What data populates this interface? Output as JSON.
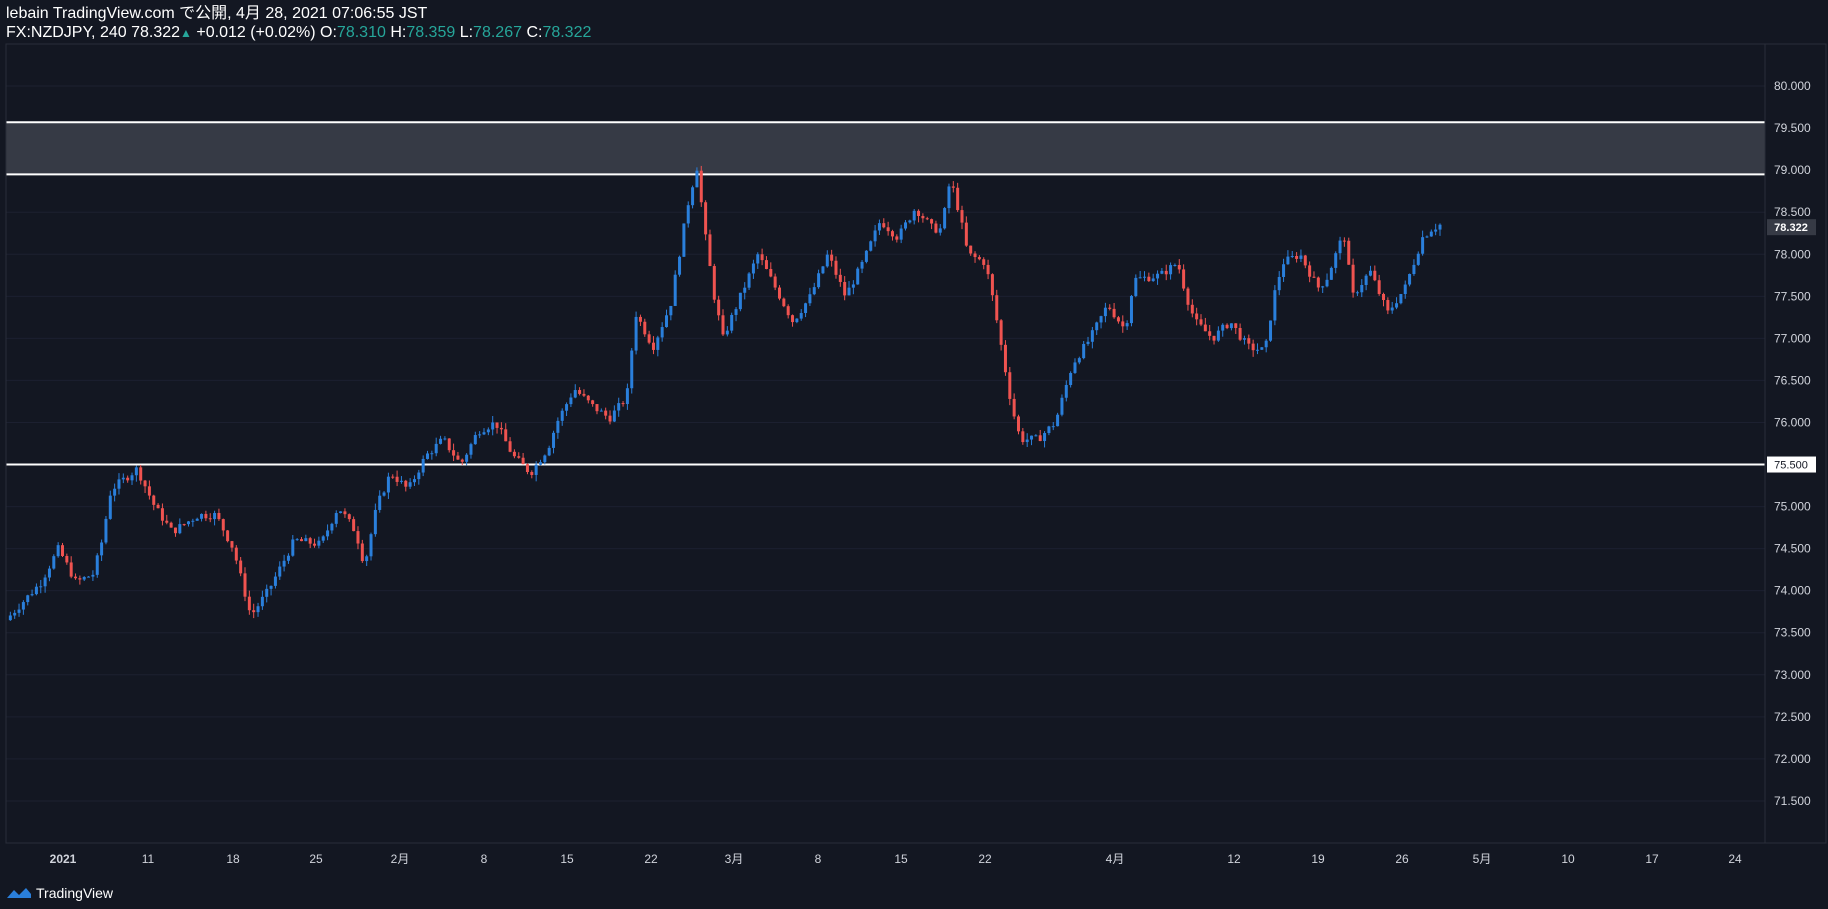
{
  "header": {
    "line1": "lebain TradingView.com で公開, 4月 28, 2021 07:06:55 JST",
    "symbol": "FX:NZDJPY, 240",
    "last": "78.322",
    "change": "+0.012 (+0.02%)",
    "o_label": "O:",
    "o": "78.310",
    "h_label": "H:",
    "h": "78.359",
    "l_label": "L:",
    "l": "78.267",
    "c_label": "C:",
    "c": "78.322"
  },
  "footer": {
    "brand": "TradingView"
  },
  "colors": {
    "background": "#131722",
    "up": "#2a7fdb",
    "down": "#ef5350",
    "zone_fill": "#363a45",
    "line": "#ffffff",
    "text": "#d1d4dc"
  },
  "chart_data": {
    "type": "candlestick",
    "symbol": "FX:NZDJPY",
    "interval": "240",
    "ylim": [
      71.0,
      80.5
    ],
    "y_ticks": [
      "80.000",
      "79.500",
      "79.000",
      "78.500",
      "78.000",
      "77.500",
      "77.000",
      "76.500",
      "76.000",
      "75.500",
      "75.000",
      "74.500",
      "74.000",
      "73.500",
      "73.000",
      "72.500",
      "72.000",
      "71.500"
    ],
    "x_ticks": [
      {
        "label": "2021",
        "bold": true
      },
      {
        "label": "11"
      },
      {
        "label": "18"
      },
      {
        "label": "25"
      },
      {
        "label": "2月"
      },
      {
        "label": "8"
      },
      {
        "label": "15"
      },
      {
        "label": "22"
      },
      {
        "label": "3月"
      },
      {
        "label": "8"
      },
      {
        "label": "15"
      },
      {
        "label": "22"
      },
      {
        "label": "4月"
      },
      {
        "label": "12"
      },
      {
        "label": "19"
      },
      {
        "label": "26"
      },
      {
        "label": "5月"
      },
      {
        "label": "10"
      },
      {
        "label": "17"
      },
      {
        "label": "24"
      }
    ],
    "resistance_zone": [
      78.95,
      79.57
    ],
    "support_line": 75.5,
    "price_labels": [
      "78.322",
      "75.500"
    ],
    "path_points": [
      {
        "x": 0.0,
        "y": 73.65
      },
      {
        "x": 0.02,
        "y": 74.1
      },
      {
        "x": 0.03,
        "y": 74.5
      },
      {
        "x": 0.04,
        "y": 74.1
      },
      {
        "x": 0.05,
        "y": 74.2
      },
      {
        "x": 0.055,
        "y": 74.6
      },
      {
        "x": 0.06,
        "y": 75.2
      },
      {
        "x": 0.075,
        "y": 75.45
      },
      {
        "x": 0.085,
        "y": 75.0
      },
      {
        "x": 0.095,
        "y": 74.7
      },
      {
        "x": 0.11,
        "y": 74.9
      },
      {
        "x": 0.12,
        "y": 74.9
      },
      {
        "x": 0.13,
        "y": 74.5
      },
      {
        "x": 0.14,
        "y": 73.7
      },
      {
        "x": 0.15,
        "y": 74.0
      },
      {
        "x": 0.165,
        "y": 74.6
      },
      {
        "x": 0.18,
        "y": 74.55
      },
      {
        "x": 0.19,
        "y": 75.0
      },
      {
        "x": 0.2,
        "y": 74.7
      },
      {
        "x": 0.205,
        "y": 74.3
      },
      {
        "x": 0.212,
        "y": 75.0
      },
      {
        "x": 0.22,
        "y": 75.4
      },
      {
        "x": 0.23,
        "y": 75.2
      },
      {
        "x": 0.24,
        "y": 75.6
      },
      {
        "x": 0.25,
        "y": 75.8
      },
      {
        "x": 0.26,
        "y": 75.5
      },
      {
        "x": 0.27,
        "y": 75.9
      },
      {
        "x": 0.28,
        "y": 76.0
      },
      {
        "x": 0.29,
        "y": 75.6
      },
      {
        "x": 0.3,
        "y": 75.4
      },
      {
        "x": 0.31,
        "y": 75.7
      },
      {
        "x": 0.315,
        "y": 76.0
      },
      {
        "x": 0.325,
        "y": 76.4
      },
      {
        "x": 0.335,
        "y": 76.2
      },
      {
        "x": 0.345,
        "y": 76.05
      },
      {
        "x": 0.355,
        "y": 76.3
      },
      {
        "x": 0.36,
        "y": 77.3
      },
      {
        "x": 0.37,
        "y": 76.9
      },
      {
        "x": 0.38,
        "y": 77.4
      },
      {
        "x": 0.385,
        "y": 78.0
      },
      {
        "x": 0.39,
        "y": 78.6
      },
      {
        "x": 0.395,
        "y": 79.05
      },
      {
        "x": 0.4,
        "y": 78.2
      },
      {
        "x": 0.405,
        "y": 77.5
      },
      {
        "x": 0.41,
        "y": 77.0
      },
      {
        "x": 0.42,
        "y": 77.5
      },
      {
        "x": 0.43,
        "y": 78.0
      },
      {
        "x": 0.44,
        "y": 77.6
      },
      {
        "x": 0.45,
        "y": 77.2
      },
      {
        "x": 0.46,
        "y": 77.5
      },
      {
        "x": 0.47,
        "y": 78.0
      },
      {
        "x": 0.48,
        "y": 77.5
      },
      {
        "x": 0.49,
        "y": 77.9
      },
      {
        "x": 0.5,
        "y": 78.4
      },
      {
        "x": 0.51,
        "y": 78.2
      },
      {
        "x": 0.52,
        "y": 78.55
      },
      {
        "x": 0.53,
        "y": 78.3
      },
      {
        "x": 0.535,
        "y": 78.3
      },
      {
        "x": 0.54,
        "y": 78.9
      },
      {
        "x": 0.545,
        "y": 78.5
      },
      {
        "x": 0.55,
        "y": 78.0
      },
      {
        "x": 0.56,
        "y": 77.9
      },
      {
        "x": 0.565,
        "y": 77.4
      },
      {
        "x": 0.57,
        "y": 76.8
      },
      {
        "x": 0.575,
        "y": 76.2
      },
      {
        "x": 0.58,
        "y": 75.8
      },
      {
        "x": 0.59,
        "y": 75.8
      },
      {
        "x": 0.6,
        "y": 76.0
      },
      {
        "x": 0.61,
        "y": 76.7
      },
      {
        "x": 0.62,
        "y": 77.0
      },
      {
        "x": 0.63,
        "y": 77.4
      },
      {
        "x": 0.64,
        "y": 77.1
      },
      {
        "x": 0.645,
        "y": 77.7
      },
      {
        "x": 0.66,
        "y": 77.75
      },
      {
        "x": 0.67,
        "y": 77.9
      },
      {
        "x": 0.675,
        "y": 77.5
      },
      {
        "x": 0.68,
        "y": 77.2
      },
      {
        "x": 0.69,
        "y": 77.0
      },
      {
        "x": 0.7,
        "y": 77.2
      },
      {
        "x": 0.71,
        "y": 76.9
      },
      {
        "x": 0.72,
        "y": 76.85
      },
      {
        "x": 0.725,
        "y": 77.5
      },
      {
        "x": 0.73,
        "y": 77.9
      },
      {
        "x": 0.74,
        "y": 78.0
      },
      {
        "x": 0.75,
        "y": 77.6
      },
      {
        "x": 0.755,
        "y": 77.7
      },
      {
        "x": 0.765,
        "y": 78.25
      },
      {
        "x": 0.77,
        "y": 77.5
      },
      {
        "x": 0.78,
        "y": 77.8
      },
      {
        "x": 0.79,
        "y": 77.3
      },
      {
        "x": 0.8,
        "y": 77.6
      },
      {
        "x": 0.81,
        "y": 78.2
      },
      {
        "x": 0.815,
        "y": 78.3
      },
      {
        "x": 0.82,
        "y": 78.35
      }
    ]
  }
}
